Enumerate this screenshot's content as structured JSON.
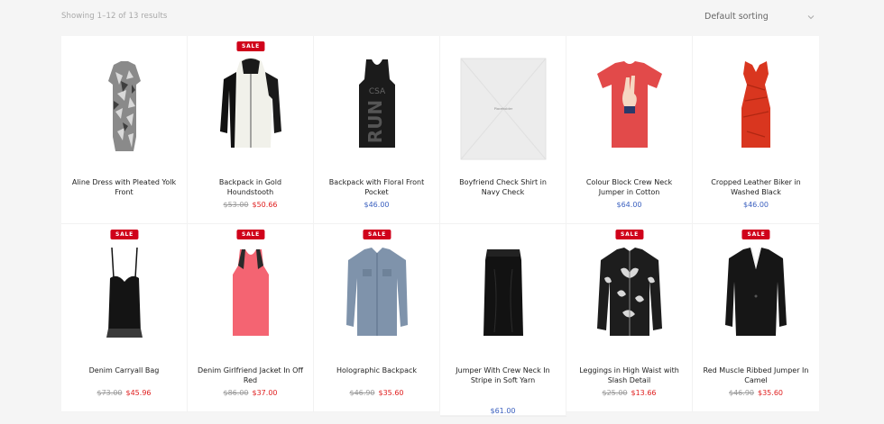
{
  "header": {
    "result_count": "Showing 1–12 of 13 results",
    "sort_selected": "Default sorting"
  },
  "colors": {
    "sale_badge": "#d0021b",
    "sale_price": "#e02020",
    "regular_price": "#3a5fbf",
    "old_price": "#9a9a9a"
  },
  "products": [
    {
      "title": "Aline Dress with Pleated Yolk Front",
      "sale": false,
      "badge": "",
      "old_price": "",
      "price": "",
      "image": "camo-dress"
    },
    {
      "title": "Backpack in Gold Houndstooth",
      "sale": true,
      "badge": "SALE",
      "old_price": "$53.00",
      "price": "$50.66",
      "image": "hoodie-jacket"
    },
    {
      "title": "Backpack with Floral Front Pocket",
      "sale": false,
      "badge": "",
      "old_price": "",
      "price": "$46.00",
      "image": "black-tank"
    },
    {
      "title": "Boyfriend Check Shirt in Navy Check",
      "sale": false,
      "badge": "",
      "old_price": "",
      "price": "",
      "image": "placeholder"
    },
    {
      "title": "Colour Block Crew Neck Jumper in Cotton",
      "sale": false,
      "badge": "",
      "old_price": "",
      "price": "$64.00",
      "image": "red-tshirt"
    },
    {
      "title": "Cropped Leather Biker in Washed Black",
      "sale": false,
      "badge": "",
      "old_price": "",
      "price": "$46.00",
      "image": "red-dress"
    },
    {
      "title": "Denim Carryall Bag",
      "sale": true,
      "badge": "SALE",
      "old_price": "$73.00",
      "price": "$45.96",
      "image": "black-bustier"
    },
    {
      "title": "Denim Girlfriend Jacket In Off Red",
      "sale": true,
      "badge": "SALE",
      "old_price": "$86.00",
      "price": "$37.00",
      "image": "pink-tank"
    },
    {
      "title": "Holographic Backpack",
      "sale": true,
      "badge": "SALE",
      "old_price": "$46.90",
      "price": "$35.60",
      "image": "denim-shirt"
    },
    {
      "title": "Jumper With Crew Neck In Stripe in Soft Yarn",
      "sale": false,
      "badge": "",
      "old_price": "",
      "price": "$61.00",
      "image": "pencil-skirt"
    },
    {
      "title": "Leggings in High Waist with Slash Detail",
      "sale": true,
      "badge": "SALE",
      "old_price": "$25.00",
      "price": "$13.66",
      "image": "floral-jacket"
    },
    {
      "title": "Red Muscle Ribbed Jumper In Camel",
      "sale": true,
      "badge": "SALE",
      "old_price": "$46.90",
      "price": "$35.60",
      "image": "black-blazer"
    }
  ],
  "placeholder_label": "Placeholder"
}
